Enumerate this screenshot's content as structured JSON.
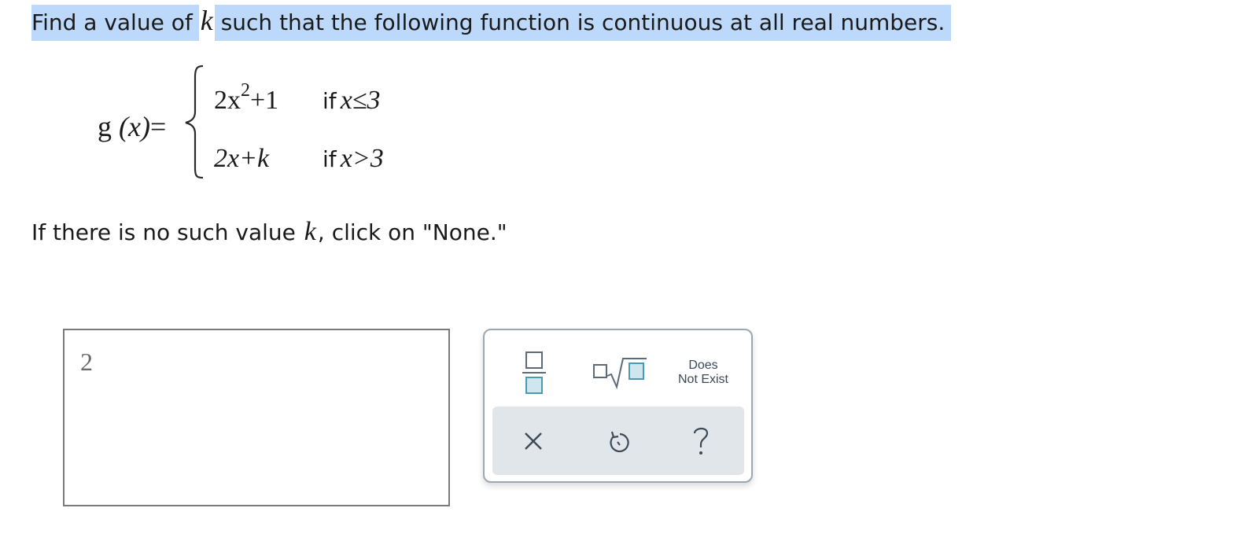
{
  "question": {
    "part1": "Find a value of",
    "k": "k",
    "part2": "such that the following function is continuous at all real numbers."
  },
  "function": {
    "name": "g",
    "arg": "(x)",
    "equals": "=",
    "piece1_coef": "2x",
    "piece1_exp": "2",
    "piece1_rest": "+1",
    "piece1_if": "if",
    "piece1_cond": "x≤3",
    "piece2_expr": "2x+k",
    "piece2_if": "if",
    "piece2_cond": "x>3"
  },
  "note": {
    "part1": "If there is no such value",
    "k": "k",
    "part2": ", click on \"None.\""
  },
  "answer": {
    "value": "2"
  },
  "palette": {
    "dne_line1": "Does",
    "dne_line2": "Not Exist",
    "icons": [
      "fraction-icon",
      "nth-root-icon",
      "clear-icon",
      "undo-icon",
      "help-icon"
    ],
    "accent": "#4a9bb0"
  }
}
